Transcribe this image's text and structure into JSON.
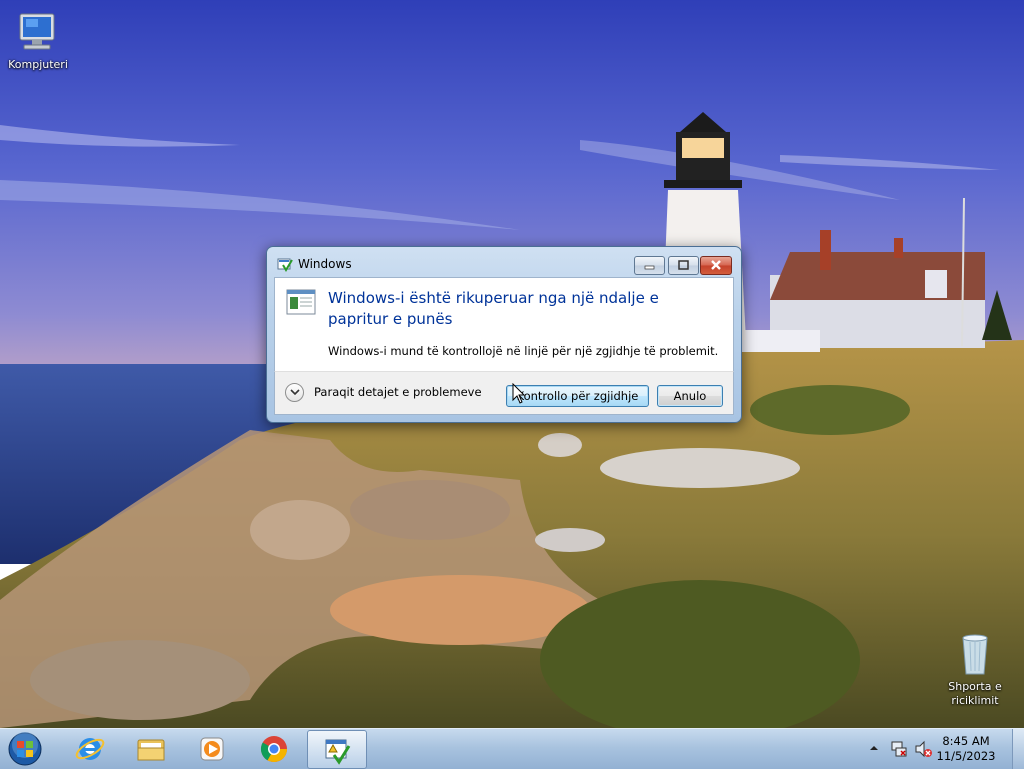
{
  "desktop": {
    "icons": [
      {
        "name": "computer",
        "label": "Kompjuteri"
      },
      {
        "name": "recycle-bin",
        "label": "Shporta e riciklimit"
      }
    ]
  },
  "dialog": {
    "title": "Windows",
    "heading": "Windows-i është rikuperuar nga një ndalje e papritur e punës",
    "description": "Windows-i mund të kontrollojë në linjë për një zgjidhje të problemit.",
    "details_label": "Paraqit detajet e problemeve",
    "check_button": "Kontrollo për zgjidhje",
    "cancel_button": "Anulo"
  },
  "taskbar": {
    "pinned": [
      "start-orb",
      "internet-explorer",
      "windows-explorer",
      "media-player",
      "chrome",
      "problem-reporting"
    ],
    "clock": {
      "time": "8:45 AM",
      "date": "11/5/2023"
    },
    "tray_icons": [
      "show-hidden-icons",
      "network-icon",
      "volume-muted-icon"
    ]
  },
  "colors": {
    "heading": "#003399",
    "taskbar": "#a9c3df",
    "close_button": "#c4412b"
  }
}
